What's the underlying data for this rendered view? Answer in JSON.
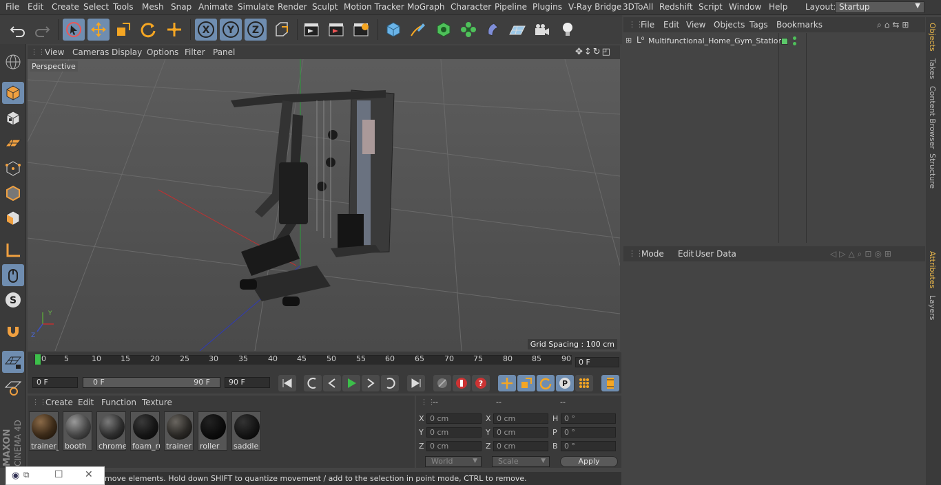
{
  "menubar": {
    "items": [
      "File",
      "Edit",
      "Create",
      "Select",
      "Tools",
      "Mesh",
      "Snap",
      "Animate",
      "Simulate",
      "Render",
      "Sculpt",
      "Motion Tracker",
      "MoGraph",
      "Character",
      "Pipeline",
      "Plugins",
      "V-Ray Bridge",
      "3DToAll",
      "Redshift",
      "Script",
      "Window",
      "Help"
    ],
    "layout_label": "Layout:",
    "layout_value": "Startup"
  },
  "viewport": {
    "menu": [
      "View",
      "Cameras",
      "Display",
      "Options",
      "Filter",
      "Panel"
    ],
    "label": "Perspective",
    "grid_spacing": "Grid Spacing : 100 cm"
  },
  "timeline": {
    "ticks": [
      "0",
      "5",
      "10",
      "15",
      "20",
      "25",
      "30",
      "35",
      "40",
      "45",
      "50",
      "55",
      "60",
      "65",
      "70",
      "75",
      "80",
      "85",
      "90"
    ],
    "current_frame": "0 F"
  },
  "transport": {
    "start_field": "0 F",
    "range_start": "0 F",
    "range_end": "90 F",
    "end_field": "90 F"
  },
  "materials": {
    "menu": [
      "Create",
      "Edit",
      "Function",
      "Texture"
    ],
    "items": [
      {
        "name": "trainer_(",
        "color": "#3b2a18"
      },
      {
        "name": "booth",
        "color": "#454545"
      },
      {
        "name": "chrome",
        "color": "#2e2e2e"
      },
      {
        "name": "foam_ru",
        "color": "#151515"
      },
      {
        "name": "trainer",
        "color": "#2a2825"
      },
      {
        "name": "roller",
        "color": "#0c0c0c"
      },
      {
        "name": "saddle",
        "color": "#141414"
      }
    ]
  },
  "coordinates": {
    "headers": [
      "--",
      "--",
      "--"
    ],
    "rows": [
      {
        "a": "X",
        "av": "0 cm",
        "b": "X",
        "bv": "0 cm",
        "c": "H",
        "cv": "0 °"
      },
      {
        "a": "Y",
        "av": "0 cm",
        "b": "Y",
        "bv": "0 cm",
        "c": "P",
        "cv": "0 °"
      },
      {
        "a": "Z",
        "av": "0 cm",
        "b": "Z",
        "bv": "0 cm",
        "c": "B",
        "cv": "0 °"
      }
    ],
    "mode_world": "World",
    "mode_scale": "Scale",
    "apply": "Apply"
  },
  "status": {
    "text": "move elements. Hold down SHIFT to quantize movement / add to the selection in point mode, CTRL to remove."
  },
  "objects": {
    "menu": [
      "File",
      "Edit",
      "View",
      "Objects",
      "Tags",
      "Bookmarks"
    ],
    "root_name": "Multifunctional_Home_Gym_Station"
  },
  "attributes": {
    "menu": [
      "Mode",
      "Edit",
      "User Data"
    ]
  },
  "side_tabs": [
    "Objects",
    "Takes",
    "Content Browser",
    "Structure",
    "Attributes",
    "Layers"
  ],
  "brand": {
    "maxon": "MAXON",
    "product": "CINEMA 4D"
  }
}
